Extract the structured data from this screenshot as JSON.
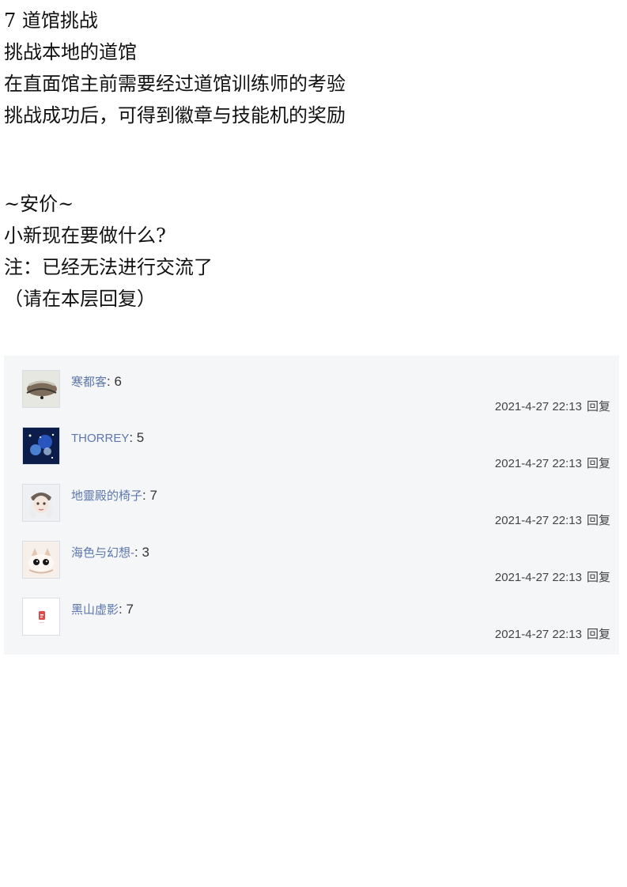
{
  "post": {
    "lines": [
      "7 道馆挑战",
      "挑战本地的道馆",
      "在直面馆主前需要经过道馆训练师的考验",
      "挑战成功后，可得到徽章与技能机的奖励",
      "~安价~",
      "小新现在要做什么?",
      "注：已经无法进行交流了",
      "（请在本层回复）"
    ]
  },
  "replies": [
    {
      "username": "寒都客",
      "text": ": 6",
      "time": "2021-4-27 22:13",
      "action": "回复",
      "avatar_icon": "avatar-landscape-icon"
    },
    {
      "username": "THORREY",
      "text": ": 5",
      "time": "2021-4-27 22:13",
      "action": "回复",
      "avatar_icon": "avatar-galaxy-icon"
    },
    {
      "username": "地靈殿的椅子",
      "text": ": 7",
      "time": "2021-4-27 22:13",
      "action": "回复",
      "avatar_icon": "avatar-anime-character-icon"
    },
    {
      "username": "海色与幻想-",
      "text": ": 3",
      "time": "2021-4-27 22:13",
      "action": "回复",
      "avatar_icon": "avatar-cat-icon"
    },
    {
      "username": "黑山虚影",
      "text": ": 7",
      "time": "2021-4-27 22:13",
      "action": "回复",
      "avatar_icon": "avatar-red-icon"
    }
  ],
  "colors": {
    "username": "#5d77ad",
    "panel_background": "#f5f6f8",
    "post_text": "#111111",
    "meta_text": "#444444"
  }
}
